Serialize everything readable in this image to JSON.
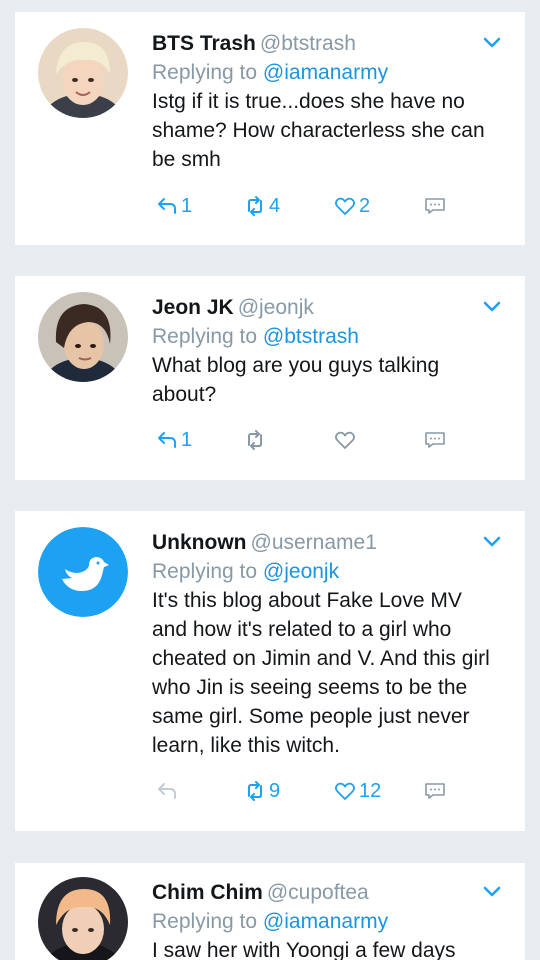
{
  "tweets": [
    {
      "display_name": "BTS Trash",
      "handle": "@btstrash",
      "replying_prefix": "Replying to",
      "replying_to": "@iamanarmy",
      "text": "Istg if it is true...does she have no shame? How characterless she can be smh",
      "reply_count": "1",
      "retweet_count": "4",
      "like_count": "2",
      "avatar_icon": "person-photo-blond-hair"
    },
    {
      "display_name": "Jeon JK",
      "handle": "@jeonjk",
      "replying_prefix": "Replying to",
      "replying_to": "@btstrash",
      "text": "What blog are you guys talking about?",
      "reply_count": "1",
      "retweet_count": "",
      "like_count": "",
      "avatar_icon": "person-photo-dark-hair"
    },
    {
      "display_name": "Unknown",
      "handle": "@username1",
      "replying_prefix": "Replying to",
      "replying_to": "@jeonjk",
      "text": "It's this blog about Fake Love MV and how it's related to a girl who cheated on Jimin and V. And this girl who Jin is seeing seems to be the same girl. Some people just never learn, like this witch.",
      "reply_count": "",
      "retweet_count": "9",
      "like_count": "12",
      "avatar_icon": "default-bird-icon"
    },
    {
      "display_name": "Chim Chim",
      "handle": "@cupoftea",
      "replying_prefix": "Replying to",
      "replying_to": "@iamanarmy",
      "text": "I saw her with Yoongi a few days",
      "reply_count": "",
      "retweet_count": "",
      "like_count": "",
      "avatar_icon": "person-photo-blond-hair"
    }
  ],
  "colors": {
    "background": "#e6ecf0",
    "card": "#ffffff",
    "accent": "#1da1f2",
    "muted": "#8899a6",
    "text": "#14171a"
  }
}
